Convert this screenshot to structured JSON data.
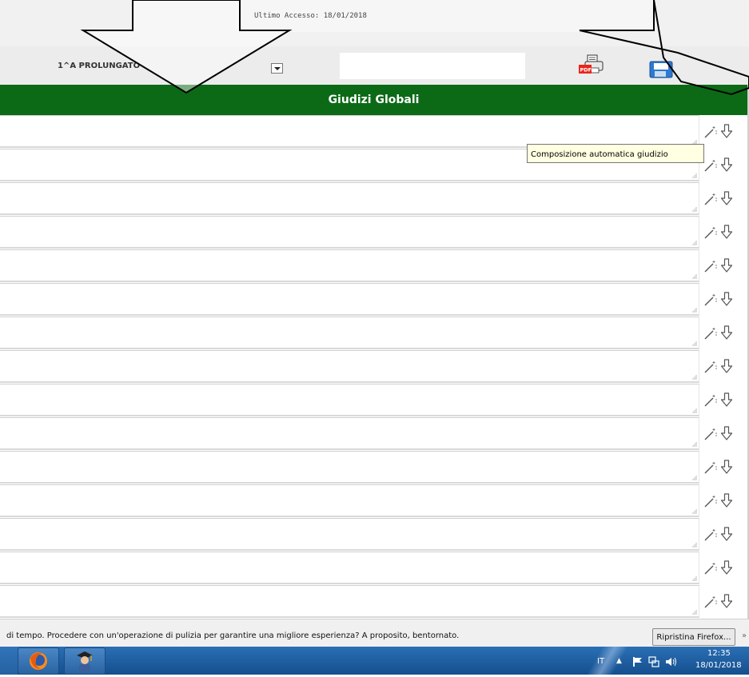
{
  "header": {
    "last_access": "Ultimo Accesso: 18/01/2018"
  },
  "toolbar": {
    "class_label": "1^A PROLUNGATO",
    "search_value": "",
    "pdf_label": "PDF"
  },
  "section": {
    "title": "Giudizi Globali"
  },
  "rows": [
    {
      "value": ""
    },
    {
      "value": ""
    },
    {
      "value": ""
    },
    {
      "value": ""
    },
    {
      "value": ""
    },
    {
      "value": ""
    },
    {
      "value": ""
    },
    {
      "value": ""
    },
    {
      "value": ""
    },
    {
      "value": ""
    },
    {
      "value": ""
    },
    {
      "value": ""
    },
    {
      "value": ""
    },
    {
      "value": ""
    },
    {
      "value": ""
    }
  ],
  "tooltip": {
    "text": "Composizione automatica giudizio"
  },
  "notification": {
    "text": "di tempo. Procedere con un'operazione di pulizia per garantire una migliore esperienza? A proposito, bentornato.",
    "button_label": "Ripristina Firefox...",
    "close_label": "»"
  },
  "taskbar": {
    "apps": [
      "firefox-icon",
      "student-icon"
    ],
    "language": "IT",
    "time": "12:35",
    "date": "18/01/2018"
  },
  "colors": {
    "section_header_bg": "#0c6a17",
    "taskbar_bg": "#1d5c9f",
    "tooltip_bg": "#ffffe1"
  }
}
